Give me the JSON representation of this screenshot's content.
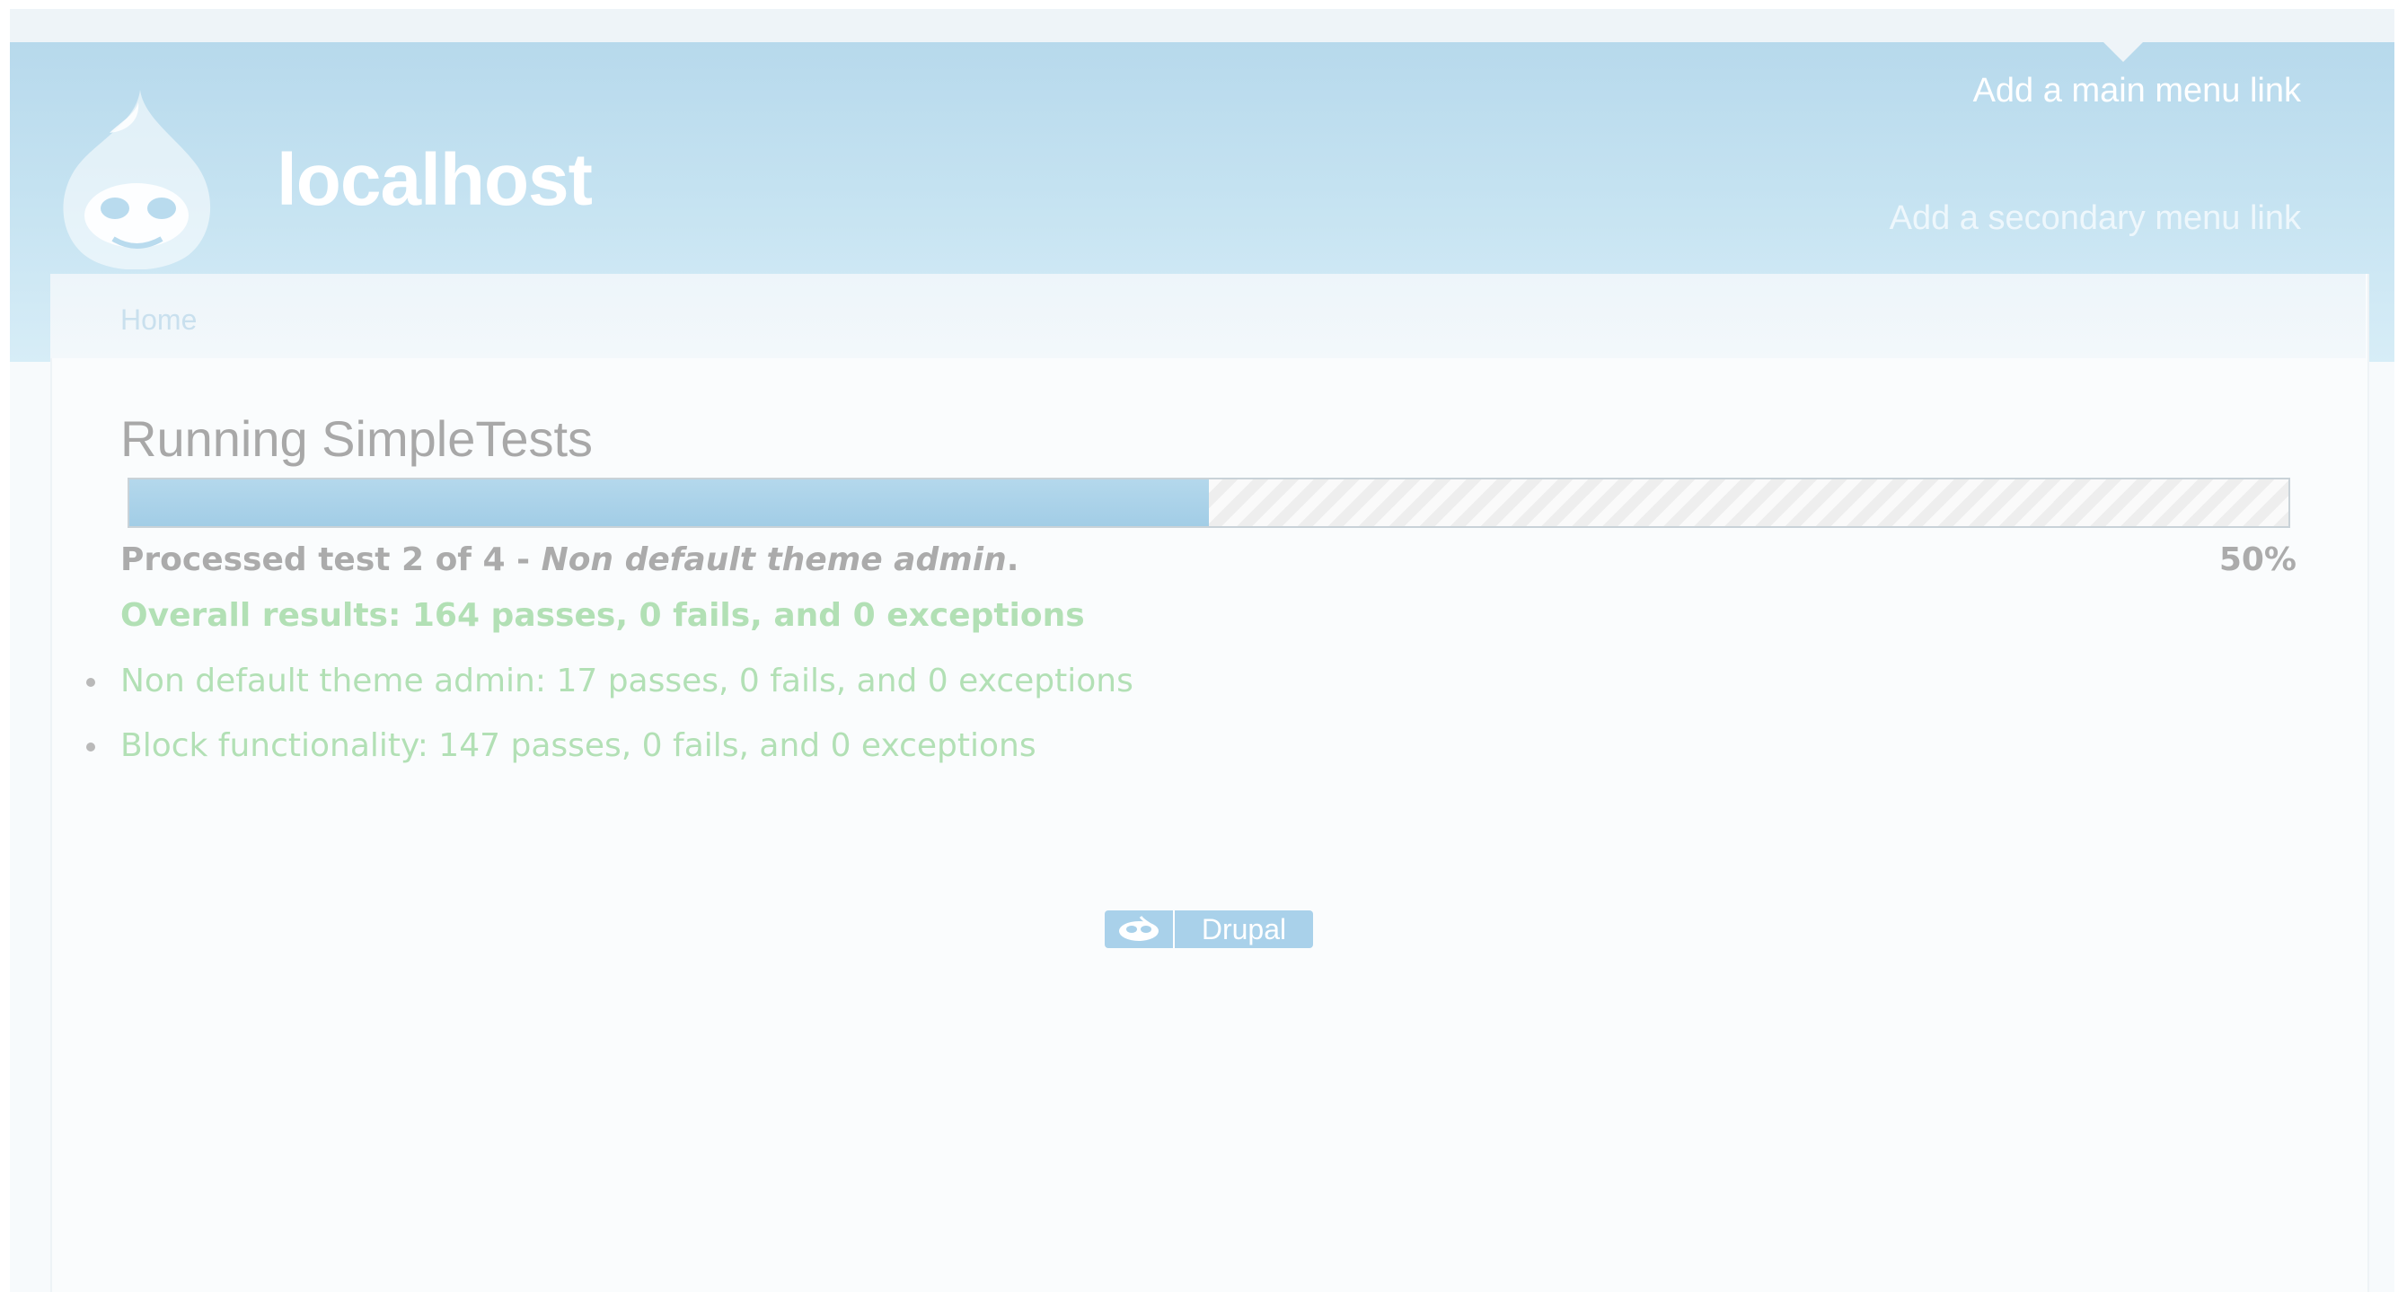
{
  "site": {
    "name": "localhost"
  },
  "menus": {
    "main_link": "Add a main menu link",
    "secondary_link": "Add a secondary menu link"
  },
  "breadcrumb": {
    "home": "Home"
  },
  "page": {
    "title": "Running SimpleTests"
  },
  "progress": {
    "fraction": 0.5,
    "message_prefix": "Processed test 2 of 4 - ",
    "current_test": "Non default theme admin",
    "message_suffix": ".",
    "percent_label": "50%"
  },
  "results": {
    "overall": "Overall results: 164 passes, 0 fails, and 0 exceptions",
    "items": [
      "Non default theme admin: 17 passes, 0 fails, and 0 exceptions",
      "Block functionality: 147 passes, 0 fails, and 0 exceptions"
    ]
  },
  "footer": {
    "badge_text": "Drupal"
  },
  "colors": {
    "header": "#c4e2f1",
    "progress_fill": "#a2cde6",
    "pass_text": "#b2e0b5",
    "badge": "#a9d1ea"
  },
  "icons": {
    "site_logo": "drupal-drop-icon",
    "badge_logo": "drupal-icon"
  }
}
